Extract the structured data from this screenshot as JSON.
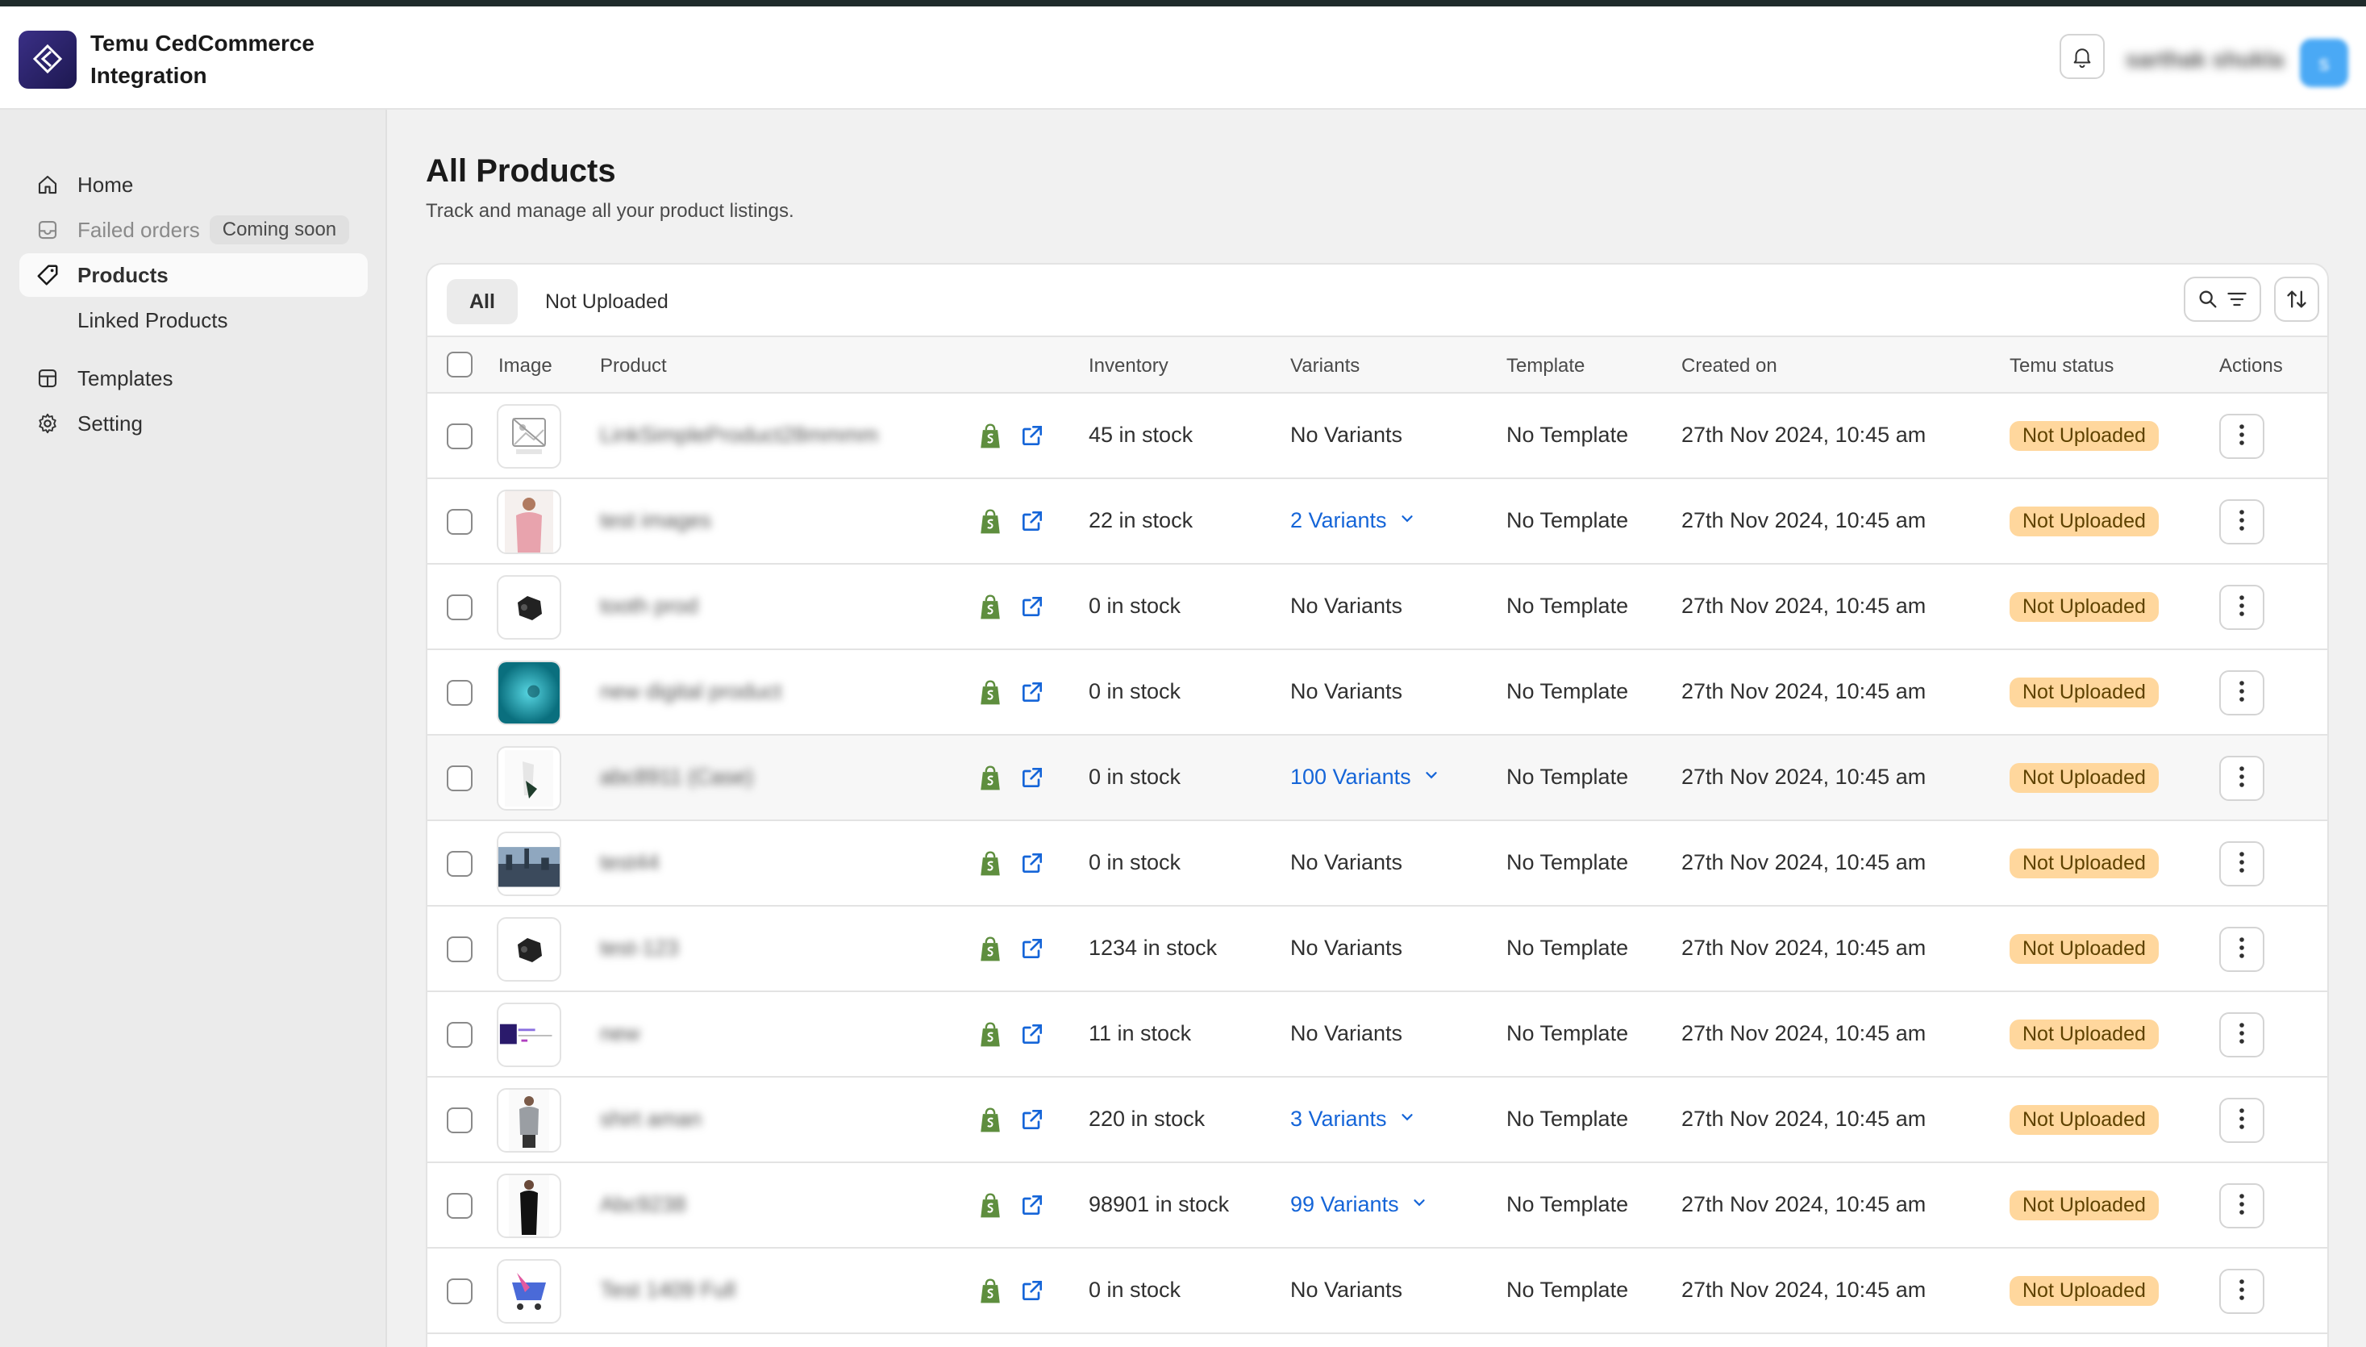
{
  "app": {
    "title": "Temu CedCommerce Integration",
    "username": "sarthak shukla",
    "avatar_initial": "s"
  },
  "sidebar": {
    "items": [
      {
        "label": "Home",
        "icon": "home-icon"
      },
      {
        "label": "Failed orders",
        "icon": "inbox-icon",
        "badge": "Coming soon"
      },
      {
        "label": "Products",
        "icon": "tag-icon"
      },
      {
        "label": "Linked Products"
      },
      {
        "label": "Templates",
        "icon": "layout-icon"
      },
      {
        "label": "Setting",
        "icon": "gear-icon"
      }
    ]
  },
  "page": {
    "title": "All Products",
    "subtitle": "Track and manage all your product listings."
  },
  "tabs": [
    {
      "label": "All"
    },
    {
      "label": "Not Uploaded"
    }
  ],
  "table": {
    "columns": [
      "Image",
      "Product",
      "Inventory",
      "Variants",
      "Template",
      "Created on",
      "Temu status",
      "Actions"
    ],
    "rows": [
      {
        "product": "LinkSimpleProduct28mmmm",
        "inventory": "45 in stock",
        "variants": "No Variants",
        "template": "No Template",
        "created": "27th Nov 2024, 10:45 am",
        "status": "Not Uploaded",
        "image": "no-image"
      },
      {
        "product": "test images",
        "inventory": "22 in stock",
        "variants": "2 Variants",
        "template": "No Template",
        "created": "27th Nov 2024, 10:45 am",
        "status": "Not Uploaded",
        "image": "person-pink"
      },
      {
        "product": "tooth prod",
        "inventory": "0 in stock",
        "variants": "No Variants",
        "template": "No Template",
        "created": "27th Nov 2024, 10:45 am",
        "status": "Not Uploaded",
        "image": "dark-object"
      },
      {
        "product": "new digital product",
        "inventory": "0 in stock",
        "variants": "No Variants",
        "template": "No Template",
        "created": "27th Nov 2024, 10:45 am",
        "status": "Not Uploaded",
        "image": "teal-water"
      },
      {
        "product": "abc8911 (Case)",
        "inventory": "0 in stock",
        "variants": "100 Variants",
        "template": "No Template",
        "created": "27th Nov 2024, 10:45 am",
        "status": "Not Uploaded",
        "image": "white-green"
      },
      {
        "product": "test44",
        "inventory": "0 in stock",
        "variants": "No Variants",
        "template": "No Template",
        "created": "27th Nov 2024, 10:45 am",
        "status": "Not Uploaded",
        "image": "city-skyline"
      },
      {
        "product": "test-123",
        "inventory": "1234 in stock",
        "variants": "No Variants",
        "template": "No Template",
        "created": "27th Nov 2024, 10:45 am",
        "status": "Not Uploaded",
        "image": "dark-object"
      },
      {
        "product": "new",
        "inventory": "11 in stock",
        "variants": "No Variants",
        "template": "No Template",
        "created": "27th Nov 2024, 10:45 am",
        "status": "Not Uploaded",
        "image": "screenshot-purple"
      },
      {
        "product": "shirt aman",
        "inventory": "220 in stock",
        "variants": "3 Variants",
        "template": "No Template",
        "created": "27th Nov 2024, 10:45 am",
        "status": "Not Uploaded",
        "image": "person-grey"
      },
      {
        "product": "Abc9238",
        "inventory": "98901 in stock",
        "variants": "99 Variants",
        "template": "No Template",
        "created": "27th Nov 2024, 10:45 am",
        "status": "Not Uploaded",
        "image": "person-black"
      },
      {
        "product": "Test 1409 Full",
        "inventory": "0 in stock",
        "variants": "No Variants",
        "template": "No Template",
        "created": "27th Nov 2024, 10:45 am",
        "status": "Not Uploaded",
        "image": "cart-pink"
      }
    ]
  },
  "colors": {
    "accent_link": "#1565d8",
    "status_bg": "#ffd79d",
    "shopify_green": "#5e8e3e"
  }
}
